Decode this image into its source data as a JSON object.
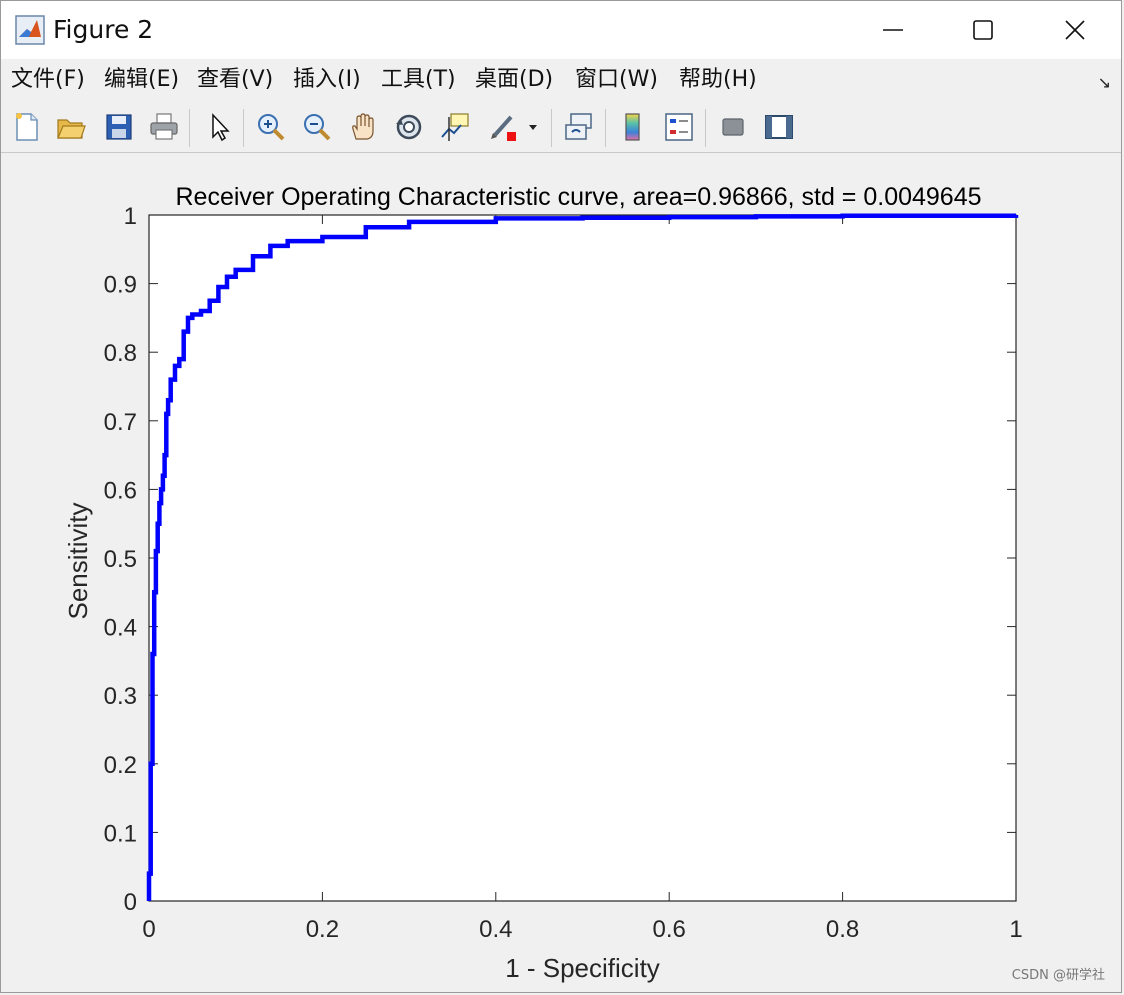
{
  "window": {
    "title": "Figure 2",
    "minimize_icon": "minimize-icon",
    "maximize_icon": "maximize-icon",
    "close_icon": "close-icon"
  },
  "menu": {
    "items": [
      "文件(F)",
      "编辑(E)",
      "查看(V)",
      "插入(I)",
      "工具(T)",
      "桌面(D)",
      "窗口(W)",
      "帮助(H)"
    ],
    "corner_icon": "dock-arrow-icon"
  },
  "toolbar": {
    "icons": [
      "new-figure-icon",
      "open-file-icon",
      "save-icon",
      "print-icon",
      "select-arrow-icon",
      "zoom-in-icon",
      "zoom-out-icon",
      "pan-hand-icon",
      "rotate-3d-icon",
      "data-cursor-icon",
      "brush-icon",
      "link-plot-icon",
      "colorbar-icon",
      "legend-icon",
      "hide-plot-tools-icon",
      "show-plot-tools-icon"
    ]
  },
  "chart_data": {
    "type": "line",
    "title": "Receiver Operating Characteristic curve, area=0.96866, std = 0.0049645",
    "xlabel": "1 - Specificity",
    "ylabel": "Sensitivity",
    "xlim": [
      0,
      1
    ],
    "ylim": [
      0,
      1
    ],
    "xticks": [
      "0",
      "0.2",
      "0.4",
      "0.6",
      "0.8",
      "1"
    ],
    "yticks": [
      "0",
      "0.1",
      "0.2",
      "0.3",
      "0.4",
      "0.5",
      "0.6",
      "0.7",
      "0.8",
      "0.9",
      "1"
    ],
    "grid": false,
    "series": [
      {
        "color": "#0000ff",
        "x": [
          0,
          0,
          0.002,
          0.002,
          0.004,
          0.004,
          0.006,
          0.006,
          0.008,
          0.008,
          0.01,
          0.012,
          0.014,
          0.016,
          0.018,
          0.02,
          0.022,
          0.025,
          0.03,
          0.035,
          0.04,
          0.045,
          0.05,
          0.06,
          0.07,
          0.08,
          0.09,
          0.1,
          0.12,
          0.14,
          0.16,
          0.2,
          0.25,
          0.3,
          0.4,
          0.5,
          0.6,
          0.7,
          0.8,
          0.9,
          1.0
        ],
        "y": [
          0,
          0.04,
          0.1,
          0.2,
          0.3,
          0.36,
          0.4,
          0.45,
          0.5,
          0.51,
          0.55,
          0.58,
          0.6,
          0.62,
          0.65,
          0.71,
          0.73,
          0.76,
          0.78,
          0.79,
          0.83,
          0.85,
          0.855,
          0.86,
          0.875,
          0.895,
          0.91,
          0.92,
          0.94,
          0.955,
          0.962,
          0.968,
          0.982,
          0.99,
          0.995,
          0.996,
          0.997,
          0.998,
          0.999,
          0.999,
          1.0
        ]
      }
    ]
  },
  "watermark": "CSDN @研学社"
}
